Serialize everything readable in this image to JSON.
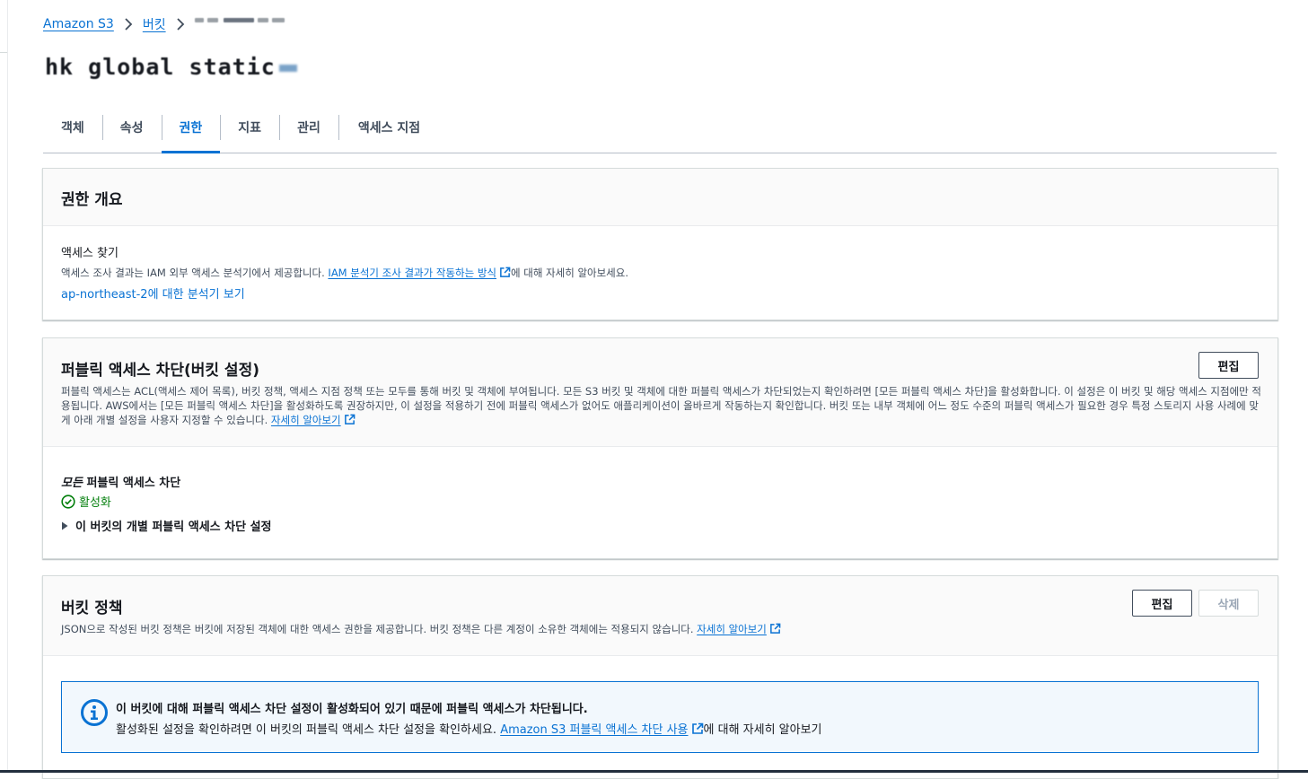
{
  "breadcrumb": {
    "items": [
      "Amazon S3",
      "버킷"
    ]
  },
  "bucket": {
    "title": "hk global static"
  },
  "tabs": [
    "객체",
    "속성",
    "권한",
    "지표",
    "관리",
    "액세스 지점"
  ],
  "overview": {
    "heading": "권한 개요",
    "access_label": "액세스 찾기",
    "desc_prefix": "액세스 조사 결과는 IAM 외부 액세스 분석기에서 제공합니다. ",
    "desc_link": "IAM 분석기 조사 결과가 작동하는 방식",
    "desc_suffix": "에 대해 자세히 알아보세요.",
    "analyzer_link": "ap-northeast-2에 대한 분석기 보기"
  },
  "bpa": {
    "heading": "퍼블릭 액세스 차단(버킷 설정)",
    "edit_label": "편집",
    "desc": "퍼블릭 액세스는 ACL(액세스 제어 목록), 버킷 정책, 액세스 지점 정책 또는 모두를 통해 버킷 및 객체에 부여됩니다. 모든 S3 버킷 및 객체에 대한 퍼블릭 액세스가 차단되었는지 확인하려면 [모든 퍼블릭 액세스 차단]을 활성화합니다. 이 설정은 이 버킷 및 해당 액세스 지점에만 적용됩니다. AWS에서는 [모든 퍼블릭 액세스 차단]을 활성화하도록 권장하지만, 이 설정을 적용하기 전에 퍼블릭 액세스가 없어도 애플리케이션이 올바르게 작동하는지 확인합니다. 버킷 또는 내부 객체에 어느 정도 수준의 퍼블릭 액세스가 필요한 경우 특정 스토리지 사용 사례에 맞게 아래 개별 설정을 사용자 지정할 수 있습니다. ",
    "learn_more": "자세히 알아보기",
    "all_italic": "모든",
    "all_rest": " 퍼블릭 액세스 차단",
    "status": "활성화",
    "expander": "이 버킷의 개별 퍼블릭 액세스 차단 설정"
  },
  "policy": {
    "heading": "버킷 정책",
    "edit_label": "편집",
    "delete_label": "삭제",
    "desc": "JSON으로 작성된 버킷 정책은 버킷에 저장된 객체에 대한 액세스 권한을 제공합니다. 버킷 정책은 다른 계정이 소유한 객체에는 적용되지 않습니다. ",
    "learn_more": "자세히 알아보기",
    "alert": {
      "title": "이 버킷에 대해 퍼블릭 액세스 차단 설정이 활성화되어 있기 때문에 퍼블릭 액세스가 차단됩니다.",
      "body_prefix": "활성화된 설정을 확인하려면 이 버킷의 퍼블릭 액세스 차단 설정을 확인하세요. ",
      "body_link": "Amazon S3 퍼블릭 액세스 차단 사용",
      "body_suffix": "에 대해 자세히 알아보기"
    }
  },
  "colors": {
    "link": "#0972d3",
    "success": "#037f0c",
    "alert_bg": "#f2f8fd"
  }
}
